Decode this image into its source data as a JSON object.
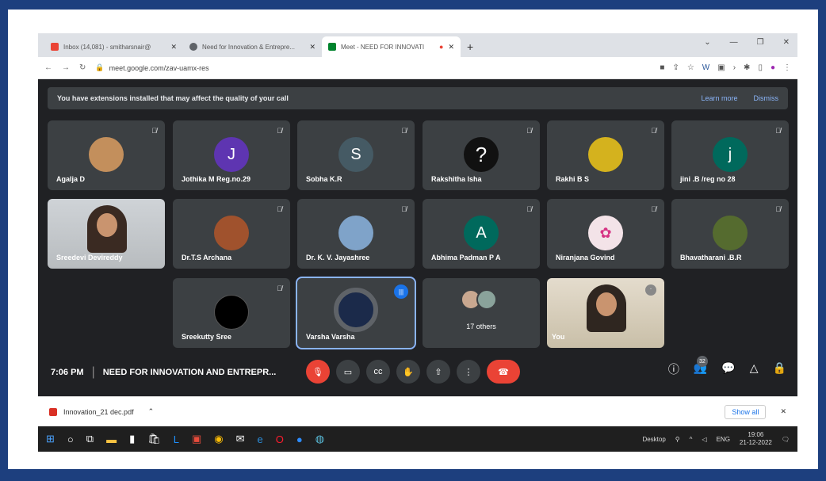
{
  "browser": {
    "tabs": [
      {
        "label": "Inbox (14,081) - smitharsnair@",
        "icon_color": "#ea4335"
      },
      {
        "label": "Need for Innovation & Entrepre...",
        "icon_color": "#5f6368"
      },
      {
        "label": "Meet - NEED FOR INNOVATI",
        "icon_color": "#00832d"
      }
    ],
    "url": "meet.google.com/zav-uamx-res"
  },
  "banner": {
    "text": "You have extensions installed that may affect the quality of your call",
    "learn_more": "Learn more",
    "dismiss": "Dismiss"
  },
  "participants": [
    {
      "name": "Agalja D",
      "initial": "",
      "color": "#c38f5c"
    },
    {
      "name": "Jothika M Reg.no.29",
      "initial": "J",
      "color": "#5e35b1"
    },
    {
      "name": "Sobha K.R",
      "initial": "S",
      "color": "#455a64"
    },
    {
      "name": "Rakshitha Isha",
      "initial": "?",
      "color": "#111111"
    },
    {
      "name": "Rakhi B S",
      "initial": "",
      "color": "#d4b21e"
    },
    {
      "name": "jini .B /reg no 28",
      "initial": "j",
      "color": "#00695c"
    },
    {
      "name": "Sreedevi Devireddy",
      "initial": "",
      "color": "#cfd3d7"
    },
    {
      "name": "Dr.T.S Archana",
      "initial": "",
      "color": "#a0522d"
    },
    {
      "name": "Dr. K. V. Jayashree",
      "initial": "",
      "color": "#7fa3c9"
    },
    {
      "name": "Abhima Padman P A",
      "initial": "A",
      "color": "#00695c"
    },
    {
      "name": "Niranjana Govind",
      "initial": "",
      "color": "#f3e3e8"
    },
    {
      "name": "Bhavatharani .B.R",
      "initial": "",
      "color": "#556b2f"
    },
    {
      "name": "Sreekutty Sree",
      "initial": "",
      "color": "#000000"
    },
    {
      "name": "Varsha Varsha",
      "initial": "",
      "color": "#1b2a4a"
    },
    {
      "name": "17 others",
      "initial": "",
      "color": "#3c4043"
    },
    {
      "name": "You",
      "initial": "",
      "color": "#cfc4b0"
    }
  ],
  "meeting": {
    "time": "7:06 PM",
    "title": "NEED FOR INNOVATION AND ENTREPR...",
    "participant_count": "32"
  },
  "download": {
    "file": "Innovation_21 dec.pdf",
    "show_all": "Show all"
  },
  "taskbar": {
    "desktop": "Desktop",
    "lang": "ENG",
    "time": "19:06",
    "date": "21-12-2022"
  }
}
